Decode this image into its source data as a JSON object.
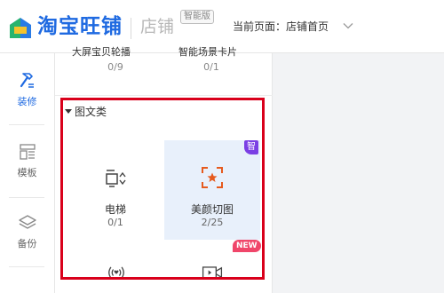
{
  "header": {
    "brand": "淘宝旺铺",
    "store": "店铺",
    "badge": "智能版",
    "current_page": "当前页面：店铺首页"
  },
  "sidebar": {
    "items": [
      {
        "label": "装修",
        "active": true
      },
      {
        "label": "模板",
        "active": false
      },
      {
        "label": "备份",
        "active": false
      }
    ]
  },
  "panel": {
    "cut_items": [
      {
        "label": "大屏宝贝轮播",
        "count": "0/9"
      },
      {
        "label": "智能场景卡片",
        "count": "0/1"
      }
    ],
    "section_title": "图文类",
    "cards": [
      {
        "name": "电梯",
        "count": "0/1"
      },
      {
        "name": "美颜切图",
        "count": "2/25",
        "tag": "智"
      }
    ],
    "new_tag": "NEW"
  },
  "colors": {
    "brand": "#1f6ae1",
    "accent": "#d9001b",
    "card_highlight": "#e8f0fb",
    "purple_tag": "#7b3fe4",
    "new_tag": "#f0466a",
    "icon_orange": "#e65a1d"
  }
}
